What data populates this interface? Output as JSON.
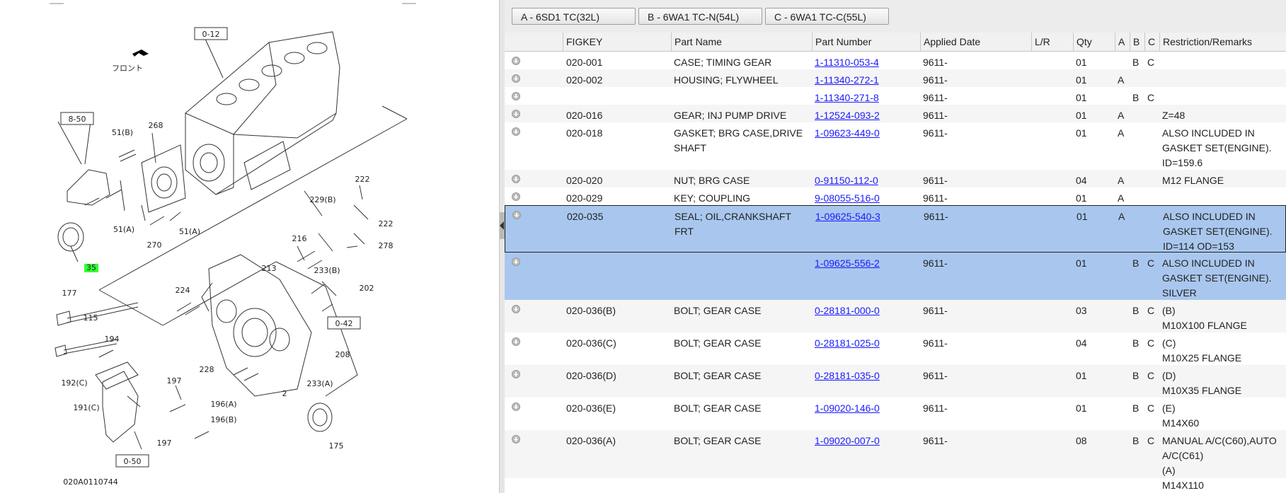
{
  "diagram": {
    "labels": [
      "0-12",
      "フロント",
      "8-50",
      "51(B)",
      "268",
      "51(A)",
      "270",
      "51(A)",
      "35",
      "222",
      "229(B)",
      "222",
      "216",
      "278",
      "213",
      "233(B)",
      "224",
      "202",
      "177",
      "115",
      "0-42",
      "194",
      "208",
      "192(C)",
      "228",
      "233(A)",
      "197",
      "2",
      "191(C)",
      "196(A)",
      "196(B)",
      "197",
      "175",
      "0-50",
      "020A0110744"
    ]
  },
  "tabs": [
    {
      "label": "A - 6SD1 TC(32L)"
    },
    {
      "label": "B - 6WA1 TC-N(54L)"
    },
    {
      "label": "C - 6WA1 TC-C(55L)"
    }
  ],
  "columns": {
    "figkey": "FIGKEY",
    "part_name": "Part Name",
    "part_number": "Part Number",
    "applied_date": "Applied Date",
    "lr": "L/R",
    "qty": "Qty",
    "a": "A",
    "b": "B",
    "c": "C",
    "remarks": "Restriction/Remarks"
  },
  "rows": [
    {
      "figkey": "020-001",
      "name": "CASE; TIMING GEAR",
      "pn": "1-11310-053-4",
      "date": "9611-",
      "lr": "",
      "qty": "01",
      "a": "",
      "b": "B",
      "c": "C",
      "remarks": ""
    },
    {
      "figkey": "020-002",
      "name": "HOUSING; FLYWHEEL",
      "pn": "1-11340-272-1",
      "date": "9611-",
      "lr": "",
      "qty": "01",
      "a": "A",
      "b": "",
      "c": "",
      "remarks": ""
    },
    {
      "figkey": "",
      "name": "",
      "pn": "1-11340-271-8",
      "date": "9611-",
      "lr": "",
      "qty": "01",
      "a": "",
      "b": "B",
      "c": "C",
      "remarks": ""
    },
    {
      "figkey": "020-016",
      "name": "GEAR; INJ PUMP DRIVE",
      "pn": "1-12524-093-2",
      "date": "9611-",
      "lr": "",
      "qty": "01",
      "a": "A",
      "b": "",
      "c": "",
      "remarks": "Z=48"
    },
    {
      "figkey": "020-018",
      "name": "GASKET; BRG CASE,DRIVE SHAFT",
      "pn": "1-09623-449-0",
      "date": "9611-",
      "lr": "",
      "qty": "01",
      "a": "A",
      "b": "",
      "c": "",
      "remarks": "ALSO INCLUDED IN GASKET SET(ENGINE). ID=159.6"
    },
    {
      "figkey": "020-020",
      "name": "NUT; BRG CASE",
      "pn": "0-91150-112-0",
      "date": "9611-",
      "lr": "",
      "qty": "04",
      "a": "A",
      "b": "",
      "c": "",
      "remarks": "M12 FLANGE"
    },
    {
      "figkey": "020-029",
      "name": "KEY; COUPLING",
      "pn": "9-08055-516-0",
      "date": "9611-",
      "lr": "",
      "qty": "01",
      "a": "A",
      "b": "",
      "c": "",
      "remarks": ""
    },
    {
      "figkey": "020-035",
      "name": "SEAL; OIL,CRANKSHAFT FRT",
      "pn": "1-09625-540-3",
      "date": "9611-",
      "lr": "",
      "qty": "01",
      "a": "A",
      "b": "",
      "c": "",
      "remarks": "ALSO INCLUDED IN GASKET SET(ENGINE). ID=114 OD=153"
    },
    {
      "figkey": "",
      "name": "",
      "pn": "1-09625-556-2",
      "date": "9611-",
      "lr": "",
      "qty": "01",
      "a": "",
      "b": "B",
      "c": "C",
      "remarks": "ALSO INCLUDED IN GASKET SET(ENGINE). SILVER"
    },
    {
      "figkey": "020-036(B)",
      "name": "BOLT; GEAR CASE",
      "pn": "0-28181-000-0",
      "date": "9611-",
      "lr": "",
      "qty": "03",
      "a": "",
      "b": "B",
      "c": "C",
      "remarks": "(B)\nM10X100 FLANGE"
    },
    {
      "figkey": "020-036(C)",
      "name": "BOLT; GEAR CASE",
      "pn": "0-28181-025-0",
      "date": "9611-",
      "lr": "",
      "qty": "04",
      "a": "",
      "b": "B",
      "c": "C",
      "remarks": "(C)\nM10X25 FLANGE"
    },
    {
      "figkey": "020-036(D)",
      "name": "BOLT; GEAR CASE",
      "pn": "0-28181-035-0",
      "date": "9611-",
      "lr": "",
      "qty": "01",
      "a": "",
      "b": "B",
      "c": "C",
      "remarks": "(D)\nM10X35 FLANGE"
    },
    {
      "figkey": "020-036(E)",
      "name": "BOLT; GEAR CASE",
      "pn": "1-09020-146-0",
      "date": "9611-",
      "lr": "",
      "qty": "01",
      "a": "",
      "b": "B",
      "c": "C",
      "remarks": "(E)\nM14X60"
    },
    {
      "figkey": "020-036(A)",
      "name": "BOLT; GEAR CASE",
      "pn": "1-09020-007-0",
      "date": "9611-",
      "lr": "",
      "qty": "08",
      "a": "",
      "b": "B",
      "c": "C",
      "remarks": "MANUAL A/C(C60),AUTO A/C(C61)\n(A)\nM14X110"
    }
  ]
}
